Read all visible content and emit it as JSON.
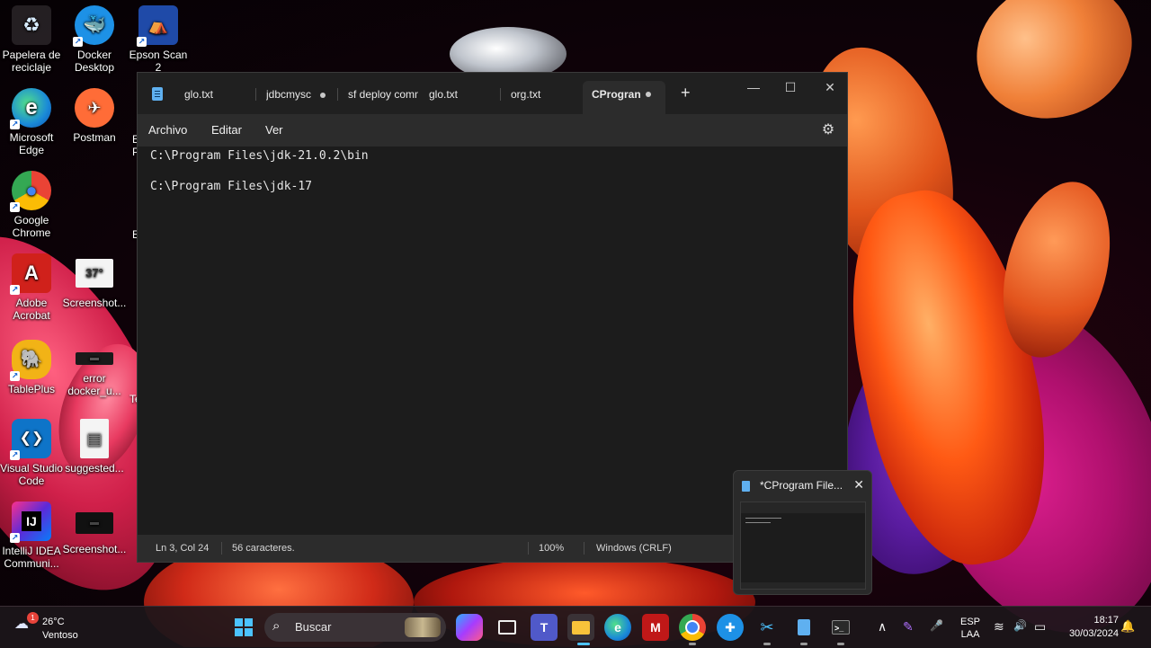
{
  "desktop": {
    "icons": [
      {
        "name": "recycle-bin",
        "label_line1": "Papelera de",
        "label_line2": "reciclaje",
        "glyph": "♻"
      },
      {
        "name": "docker-desktop",
        "label_line1": "Docker",
        "label_line2": "Desktop",
        "glyph": "🐳"
      },
      {
        "name": "epson-scan",
        "label_line1": "Epson Scan 2",
        "label_line2": "",
        "glyph": "⛺"
      },
      {
        "name": "microsoft-edge",
        "label_line1": "Microsoft",
        "label_line2": "Edge",
        "glyph": "e"
      },
      {
        "name": "postman",
        "label_line1": "Postman",
        "label_line2": "",
        "glyph": "✈"
      },
      {
        "name": "google-chrome",
        "label_line1": "Google",
        "label_line2": "Chrome",
        "glyph": "●"
      },
      {
        "name": "adobe-acrobat",
        "label_line1": "Adobe",
        "label_line2": "Acrobat",
        "glyph": "A"
      },
      {
        "name": "screenshot-1",
        "label_line1": "Screenshot...",
        "label_line2": "",
        "glyph": "37°"
      },
      {
        "name": "tableplus",
        "label_line1": "TablePlus",
        "label_line2": "",
        "glyph": "🐘"
      },
      {
        "name": "error-docker",
        "label_line1": "error",
        "label_line2": "docker_u...",
        "glyph": "▬"
      },
      {
        "name": "vscode",
        "label_line1": "Visual Studio",
        "label_line2": "Code",
        "glyph": "❮❯"
      },
      {
        "name": "suggested",
        "label_line1": "suggested...",
        "label_line2": "",
        "glyph": "▤"
      },
      {
        "name": "intellij",
        "label_line1": "IntelliJ IDEA",
        "label_line2": "Communi...",
        "glyph": "IJ"
      },
      {
        "name": "screenshot-2",
        "label_line1": "Screenshot...",
        "label_line2": "",
        "glyph": "▬"
      }
    ],
    "partial_labels": [
      "E",
      "P",
      "E",
      "Te"
    ]
  },
  "notepad": {
    "tabs": [
      {
        "label": "glo.txt",
        "modified": false
      },
      {
        "label": "jdbcmysc",
        "modified": true
      },
      {
        "label": "sf deploy comm",
        "modified": false
      },
      {
        "label": "glo.txt",
        "modified": false
      },
      {
        "label": "org.txt",
        "modified": false
      },
      {
        "label": "CProgran",
        "modified": true
      }
    ],
    "new_tab": "+",
    "window_controls": {
      "minimize": "—",
      "maximize": "☐",
      "close": "✕"
    },
    "menu": {
      "file": "Archivo",
      "edit": "Editar",
      "view": "Ver"
    },
    "settings_glyph": "⚙",
    "lines": [
      "C:\\Program Files\\jdk-21.0.2\\bin",
      "C:\\Program Files\\jdk-17"
    ],
    "status": {
      "position": "Ln 3, Col 24",
      "chars": "56 caracteres.",
      "zoom": "100%",
      "eol": "Windows (CRLF)"
    }
  },
  "preview": {
    "title": "*CProgram File...",
    "close": "✕"
  },
  "taskbar": {
    "weather": {
      "temp": "26°C",
      "desc": "Ventoso",
      "badge": "1",
      "glyph": "☁"
    },
    "search_placeholder": "Buscar",
    "search_glyph": "⌕",
    "tray": {
      "chevron": "∧",
      "pen": "✎",
      "mic": "🎤",
      "lang_top": "ESP",
      "lang_bottom": "LAA",
      "wifi": "≋",
      "volume": "🔊",
      "battery": "▭",
      "bell": "🔔"
    },
    "clock": {
      "time": "18:17",
      "date": "30/03/2024"
    }
  },
  "colors": {
    "accent": "#4cc2ff",
    "notepad_bg": "#1c1c1c",
    "taskbar_bg": "#1c161a"
  }
}
